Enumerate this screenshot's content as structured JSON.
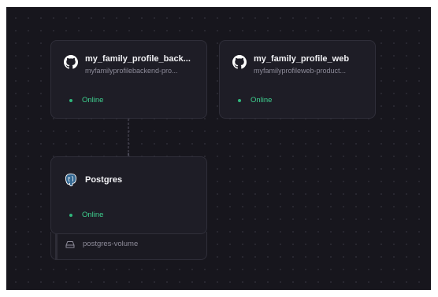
{
  "services": [
    {
      "icon": "github-icon",
      "title": "my_family_profile_back...",
      "subtitle": "myfamilyprofilebackend-pro...",
      "status": "Online"
    },
    {
      "icon": "github-icon",
      "title": "my_family_profile_web",
      "subtitle": "myfamilyprofileweb-product...",
      "status": "Online"
    },
    {
      "icon": "postgres-icon",
      "title": "Postgres",
      "status": "Online"
    }
  ],
  "volume": {
    "icon": "hard-drive-icon",
    "label": "postgres-volume"
  },
  "colors": {
    "canvas": "#17161d",
    "card": "#1e1d26",
    "online": "#3ecf8e",
    "postgres": "#336791"
  }
}
